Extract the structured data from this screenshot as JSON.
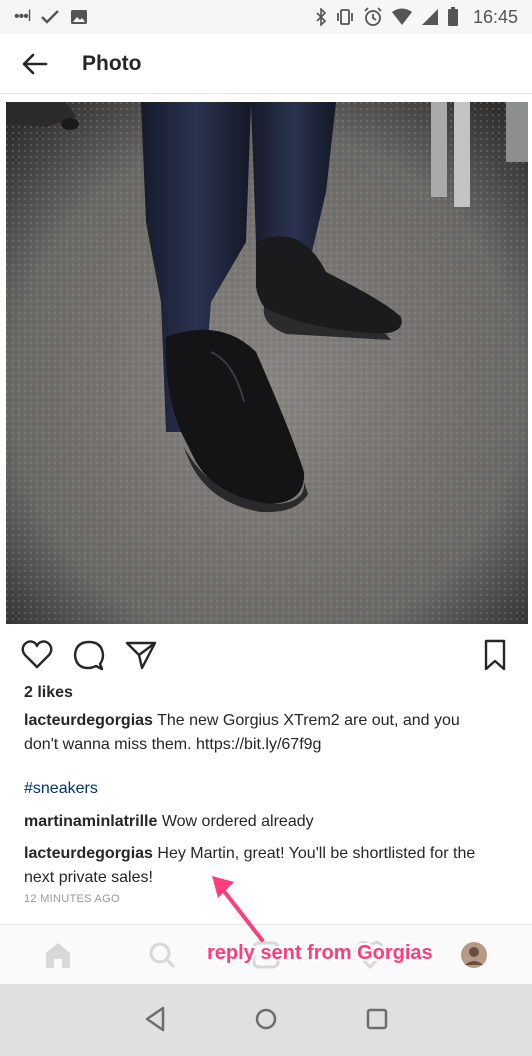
{
  "status_bar": {
    "time": "16:45",
    "left_icons": [
      "signal-dots-icon",
      "check-icon",
      "gallery-icon"
    ],
    "right_icons": [
      "bluetooth-icon",
      "vibrate-icon",
      "alarm-icon",
      "wifi-icon",
      "cell-signal-icon",
      "battery-icon"
    ]
  },
  "app_bar": {
    "back_icon": "arrow-left-icon",
    "title": "Photo"
  },
  "photo": {
    "description_icon": "photo-sneakers"
  },
  "actions": {
    "like_icon": "heart-outline-icon",
    "comment_icon": "comment-bubble-icon",
    "share_icon": "paper-plane-icon",
    "save_icon": "bookmark-icon"
  },
  "post": {
    "likes": "2 likes",
    "author": "lacteurdegorgias",
    "caption": "The new Gorgius XTrem2 are out, and you don't wanna miss them. https://bit.ly/67f9g",
    "hashtag": "#sneakers",
    "comments": [
      {
        "user": "martinaminlatrille",
        "text": "Wow ordered already"
      },
      {
        "user": "lacteurdegorgias",
        "text": "Hey Martin, great! You'll be shortlisted for the next private sales!"
      }
    ],
    "timestamp": "12 MINUTES AGO"
  },
  "tab_bar": {
    "items": [
      "home-icon",
      "search-icon",
      "add-icon",
      "heart-icon",
      "profile-icon"
    ]
  },
  "annotation": {
    "text": "reply sent from Gorgias",
    "color": "#ff3d7a"
  },
  "nav_bar": {
    "items": [
      "back-triangle-icon",
      "home-circle-icon",
      "recents-square-icon"
    ]
  }
}
